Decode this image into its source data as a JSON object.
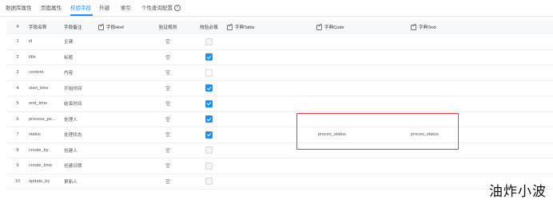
{
  "tabs": [
    {
      "label": "数据库属性",
      "active": false
    },
    {
      "label": "页面属性",
      "active": false
    },
    {
      "label": "校验字段",
      "active": true
    },
    {
      "label": "外键",
      "active": false
    },
    {
      "label": "索引",
      "active": false
    },
    {
      "label": "个性查询配置",
      "active": false
    }
  ],
  "columns": {
    "idx": "#",
    "name": "字段名称",
    "comment": "字段备注",
    "href": "字段Href",
    "rule": "验证规则",
    "required": "校验必填",
    "dict_table": "字典Table",
    "dict_code": "字典Code",
    "dict_text": "字典Text"
  },
  "rows": [
    {
      "idx": "1",
      "name": "id",
      "comment": "主键",
      "rule": "空",
      "required": "disabled",
      "code": "",
      "text": ""
    },
    {
      "idx": "2",
      "name": "title",
      "comment": "标题",
      "rule": "空",
      "required": "checked",
      "code": "",
      "text": ""
    },
    {
      "idx": "3",
      "name": "content",
      "comment": "内容",
      "rule": "空",
      "required": "unchecked",
      "code": "",
      "text": ""
    },
    {
      "idx": "4",
      "name": "start_time",
      "comment": "开始时间",
      "rule": "空",
      "required": "checked",
      "code": "",
      "text": ""
    },
    {
      "idx": "5",
      "name": "end_time",
      "comment": "结束时间",
      "rule": "空",
      "required": "checked",
      "code": "",
      "text": ""
    },
    {
      "idx": "6",
      "name": "process_pe...",
      "comment": "处理人",
      "rule": "空",
      "required": "checked",
      "code": "",
      "text": ""
    },
    {
      "idx": "7",
      "name": "status",
      "comment": "处理状态",
      "rule": "空",
      "required": "checked",
      "code": "proces_status",
      "text": "proces_status"
    },
    {
      "idx": "8",
      "name": "create_by",
      "comment": "创建人",
      "rule": "空",
      "required": "disabled",
      "code": "",
      "text": ""
    },
    {
      "idx": "9",
      "name": "create_time",
      "comment": "创建日期",
      "rule": "空",
      "required": "disabled",
      "code": "",
      "text": ""
    },
    {
      "idx": "10",
      "name": "update_by",
      "comment": "更新人",
      "rule": "空",
      "required": "disabled",
      "code": "",
      "text": ""
    }
  ],
  "colors": {
    "accent": "#1890ff",
    "highlight_box": "#e8413c"
  },
  "watermark": "油炸小波"
}
